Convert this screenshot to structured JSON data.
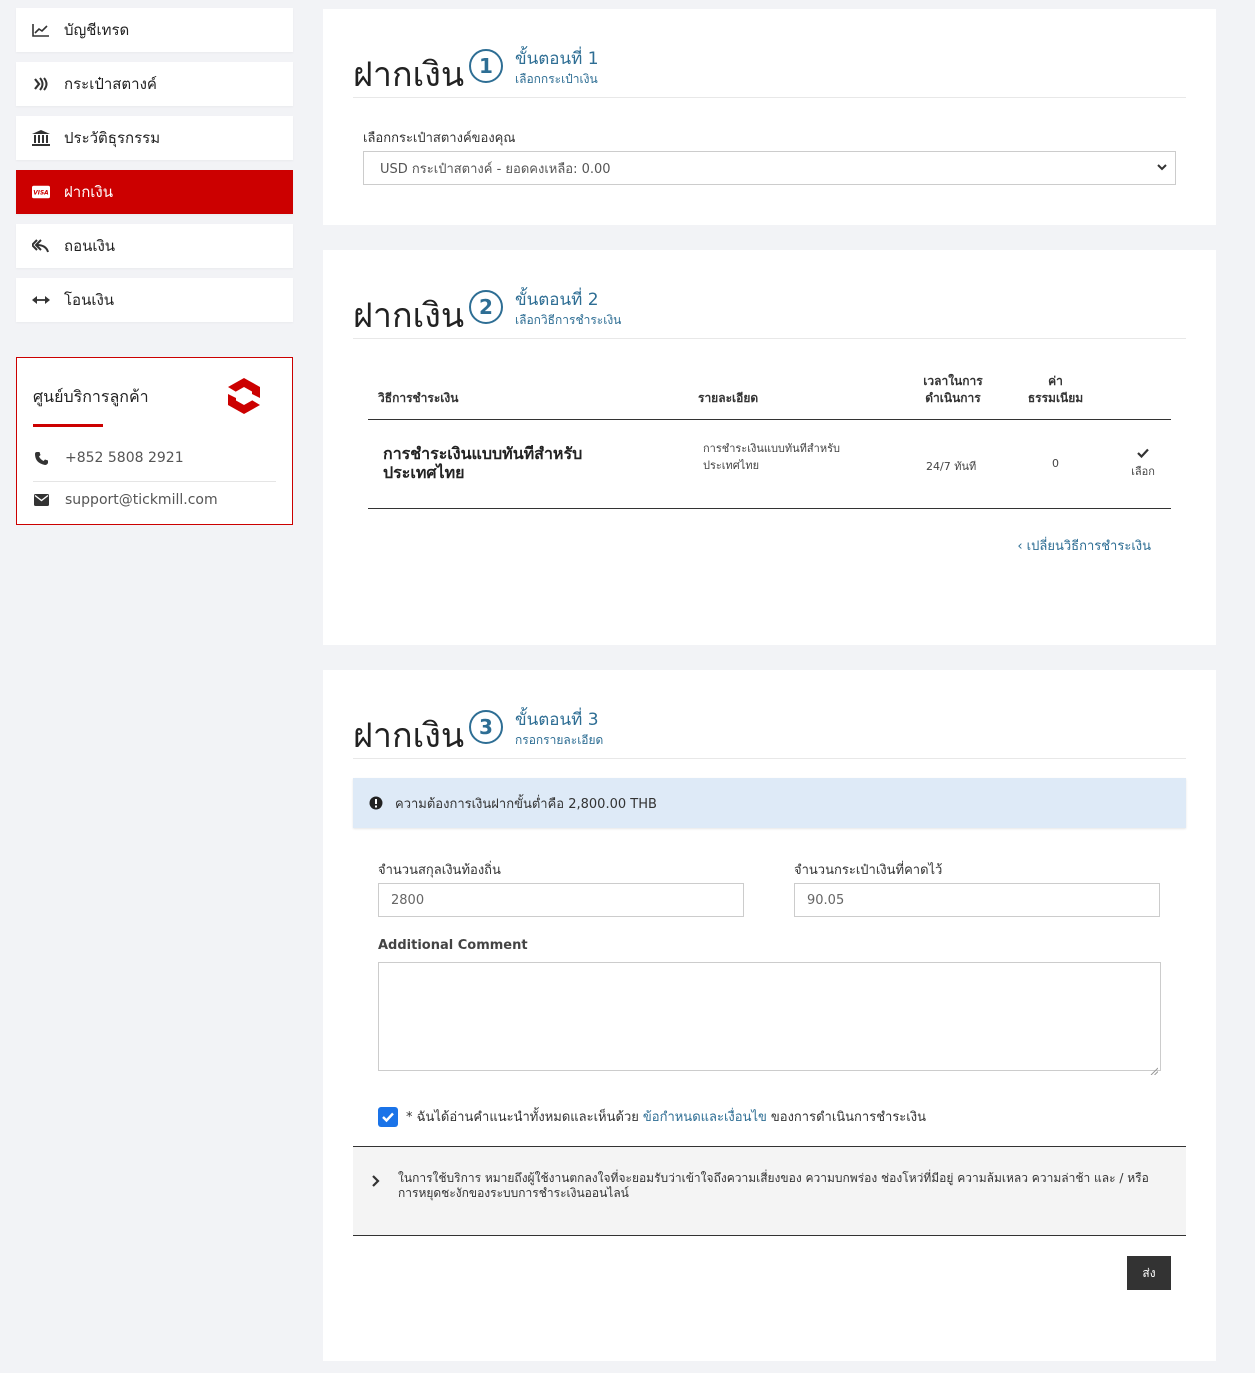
{
  "sidebar": {
    "items": [
      {
        "label": "บัญชีเทรด",
        "icon": "chart-line-icon"
      },
      {
        "label": "กระเป๋าสตางค์",
        "icon": "wallet-icon"
      },
      {
        "label": "ประวัติธุรกรรม",
        "icon": "bank-icon"
      },
      {
        "label": "ฝากเงิน",
        "icon": "visa-card-icon",
        "active": true
      },
      {
        "label": "ถอนเงิน",
        "icon": "reply-all-icon"
      },
      {
        "label": "โอนเงิน",
        "icon": "arrows-horizontal-icon"
      }
    ],
    "active_color": "#cc0000"
  },
  "support": {
    "title": "ศูนย์บริการลูกค้า",
    "phone": "+852 5808 2921",
    "email": "support@tickmill.com"
  },
  "step1": {
    "title": "ฝากเงิน",
    "number": "1",
    "step_label": "ขั้นตอนที่ 1",
    "step_sub": "เลือกกระเป๋าเงิน",
    "wallet_label": "เลือกกระเป๋าสตางค์ของคุณ",
    "wallet_selected": "USD กระเป๋าสตางค์ - ยอดคงเหลือ: 0.00"
  },
  "step2": {
    "title": "ฝากเงิน",
    "number": "2",
    "step_label": "ขั้นตอนที่ 2",
    "step_sub": "เลือกวิธีการชำระเงิน",
    "columns": {
      "method": "วิธีการชำระเงิน",
      "details": "รายละเอียด",
      "time_1": "เวลาในการ",
      "time_2": "ดำเนินการ",
      "fee_1": "ค่า",
      "fee_2": "ธรรมเนียม"
    },
    "row": {
      "name": "การชำระเงินแบบทันทีสำหรับประเทศไทย",
      "details": "การชำระเงินแบบทันทีสำหรับประเทศไทย",
      "time": "24/7 ทันที",
      "fee": "0",
      "choose": "เลือก"
    },
    "change_link": "‹ เปลี่ยนวิธีการชำระเงิน"
  },
  "step3": {
    "title": "ฝากเงิน",
    "number": "3",
    "step_label": "ขั้นตอนที่ 3",
    "step_sub": "กรอกรายละเอียด",
    "alert": "ความต้องการเงินฝากขั้นต่ำคือ 2,800.00 THB",
    "local_amount_label": "จำนวนสกุลเงินท้องถิ่น",
    "local_amount_value": "2800",
    "expected_label": "จำนวนกระเป๋าเงินที่คาดไว้",
    "expected_value": "90.05",
    "comment_label": "Additional Comment",
    "consent_prefix": "* ฉันได้อ่านคำแนะนำทั้งหมดและเห็นด้วย",
    "consent_link": "ข้อกำหนดและเงื่อนไข",
    "consent_suffix": "ของการดำเนินการชำระเงิน",
    "consent_checked": true,
    "disclaimer": "ในการใช้บริการ หมายถึงผู้ใช้งานตกลงใจที่จะยอมรับว่าเข้าใจถึงความเสี่ยงของ ความบกพร่อง ช่องโหว่ที่มีอยู่ ความล้มเหลว ความล่าช้า และ / หรือการหยุดชะงักของระบบการชำระเงินออนไลน์",
    "submit": "ส่ง"
  },
  "colors": {
    "accent": "#2e6e94",
    "brand": "#cc0000",
    "checkbox": "#1a73e8"
  }
}
